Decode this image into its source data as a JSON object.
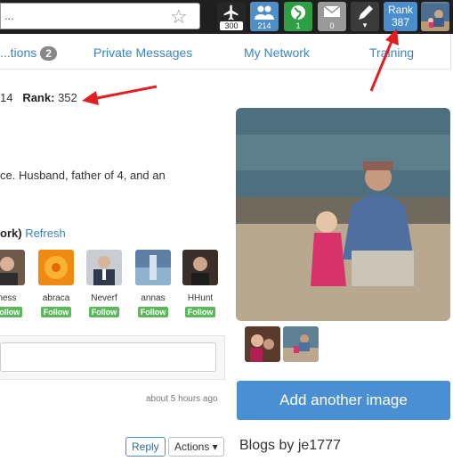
{
  "topbar": {
    "search_text": "...",
    "counts": {
      "flights": "300",
      "users": "214",
      "globe": "1",
      "mail": "0"
    },
    "rank_label": "Rank",
    "rank_value": "387"
  },
  "tabs": [
    {
      "label": "...tions",
      "badge": "2"
    },
    {
      "label": "Private Messages"
    },
    {
      "label": "My Network"
    },
    {
      "label": "Training"
    }
  ],
  "profile": {
    "stat_fragment": "14",
    "rank_label": "Rank:",
    "rank_value": "352",
    "bio": "ce. Husband, father of 4, and an"
  },
  "network": {
    "title": "ork)",
    "refresh_label": "Refresh",
    "friends": [
      {
        "name": "ness",
        "follow": "Follow"
      },
      {
        "name": "abraca",
        "follow": "Follow"
      },
      {
        "name": "Neverf",
        "follow": "Follow"
      },
      {
        "name": "annas",
        "follow": "Follow"
      },
      {
        "name": "HHunt",
        "follow": "Follow"
      }
    ]
  },
  "comment": {
    "placeholder": "",
    "timestamp": "about 5 hours ago"
  },
  "buttons": {
    "reply": "Reply",
    "actions": "Actions ▾"
  },
  "sidebar": {
    "add_image": "Add another image",
    "blogs": "Blogs by je1777"
  },
  "colors": {
    "accent": "#4a8fd2",
    "follow": "#5cb85c",
    "arrow": "#e02020"
  }
}
